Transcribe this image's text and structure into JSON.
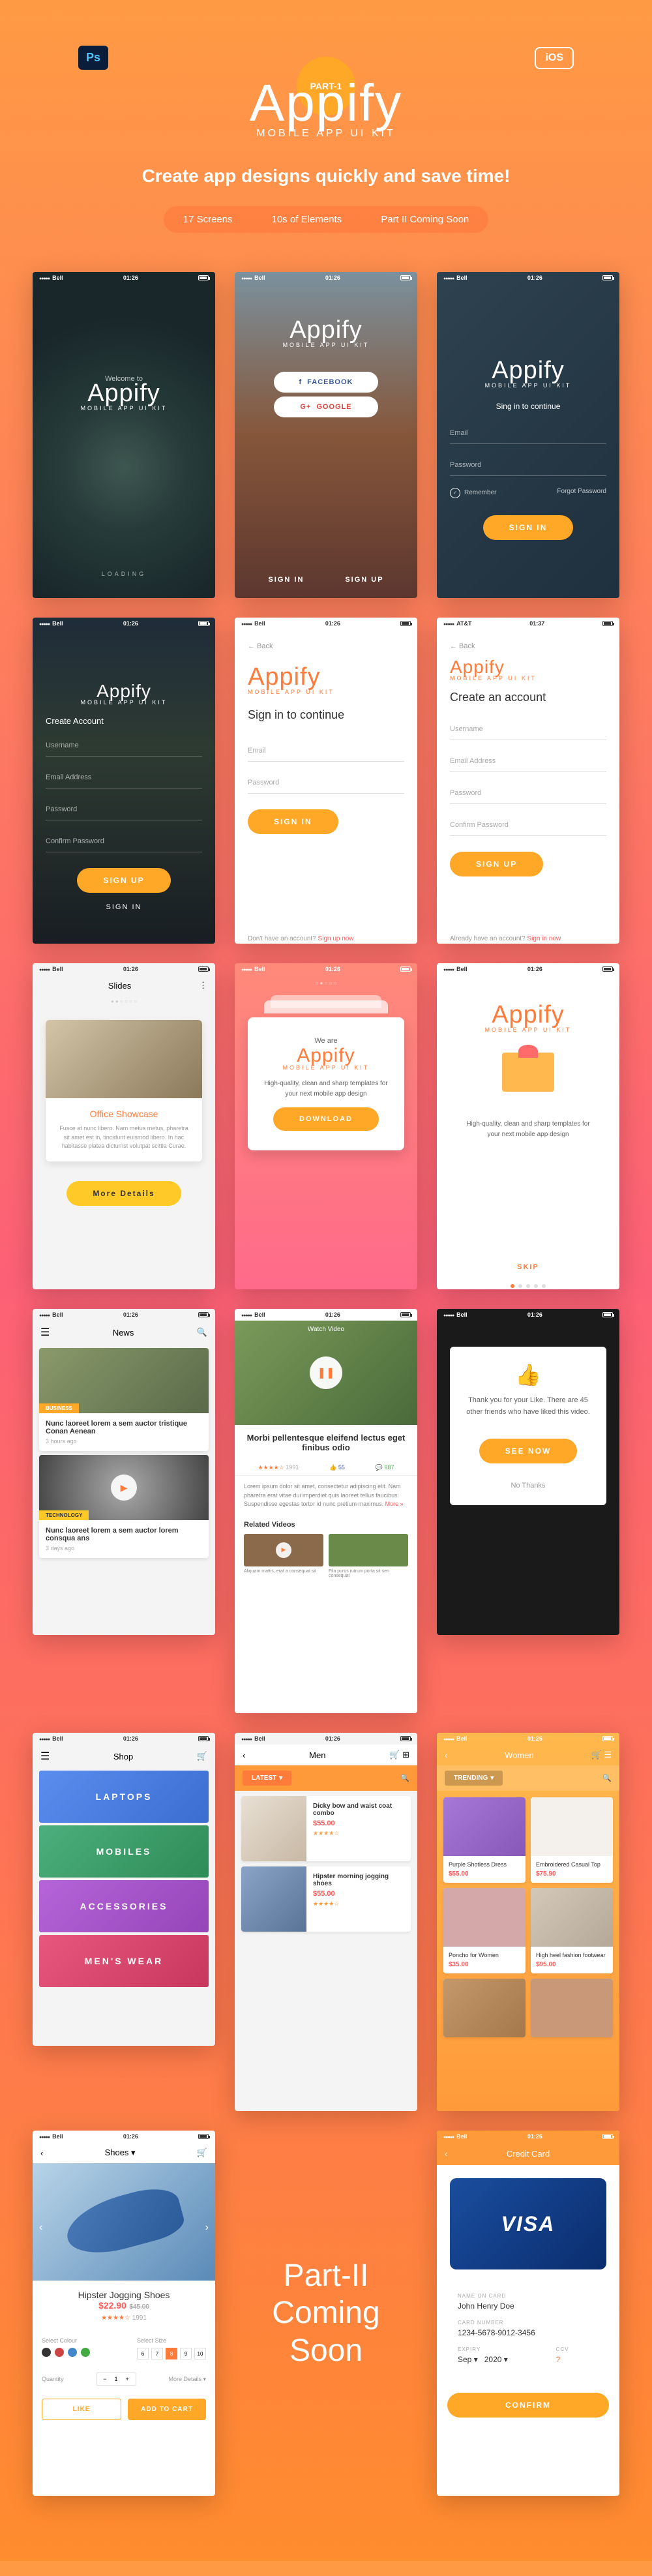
{
  "hero": {
    "part": "PART-1",
    "title": "Appify",
    "subtitle": "MOBILE APP UI KIT",
    "tagline": "Create app designs quickly and save time!",
    "pills": [
      "17 Screens",
      "10s of Elements",
      "Part II Coming Soon"
    ],
    "ps": "Ps",
    "ios": "iOS"
  },
  "status": {
    "carrier": "Bell",
    "time": "01:26",
    "att": "AT&T",
    "time2": "01:37"
  },
  "s1": {
    "welcome": "Welcome to",
    "title": "Appify",
    "sub": "MOBILE APP UI KIT",
    "loading": "LOADING"
  },
  "s2": {
    "title": "Appify",
    "sub": "MOBILE APP UI KIT",
    "fb": "FACEBOOK",
    "gg": "GOOGLE",
    "signin": "SIGN IN",
    "signup": "SIGN UP"
  },
  "s3": {
    "title": "Appify",
    "sub": "MOBILE APP UI KIT",
    "heading": "Sing in to continue",
    "email": "Email",
    "password": "Password",
    "remember": "Remember",
    "forgot": "Forgot Password",
    "btn": "SIGN IN"
  },
  "s4": {
    "title": "Appify",
    "sub": "MOBILE APP UI KIT",
    "heading": "Create Account",
    "f1": "Username",
    "f2": "Email Address",
    "f3": "Password",
    "f4": "Confirm Password",
    "btn": "SIGN UP",
    "link": "SIGN IN"
  },
  "s5": {
    "back": "← Back",
    "title": "Appify",
    "sub": "MOBILE APP UI KIT",
    "heading": "Sign in to continue",
    "f1": "Email",
    "f2": "Password",
    "btn": "SIGN IN",
    "footer": "Don't have an account?",
    "footerLink": "Sign up now"
  },
  "s6": {
    "back": "← Back",
    "title": "Appify",
    "sub": "MOBILE APP UI KIT",
    "heading": "Create an account",
    "f1": "Username",
    "f2": "Email Address",
    "f3": "Password",
    "f4": "Confirm Password",
    "btn": "SIGN UP",
    "footer": "Already have an account?",
    "footerLink": "Sign in now"
  },
  "s7": {
    "header": "Slides",
    "title": "Office Showcase",
    "desc": "Fusce at nunc libero. Nam metus metus, pharetra sit amet est in, tincidunt euismod libero. In hac habitasse platea dictumst volutpat scittla Curae.",
    "btn": "More Details"
  },
  "s8": {
    "pre": "We are",
    "title": "Appify",
    "sub": "MOBILE APP UI KIT",
    "desc": "High-quality, clean and sharp templates for your next mobile app design",
    "btn": "DOWNLOAD"
  },
  "s9": {
    "title": "Appify",
    "sub": "MOBILE APP UI KIT",
    "desc": "High-quality, clean and sharp templates for your next mobile app design",
    "skip": "SKIP"
  },
  "s10": {
    "header": "News",
    "tag1": "BUSINESS",
    "t1": "Nunc laoreet lorem a sem auctor tristique Conan Aenean",
    "m1": "3 hours ago",
    "tag2": "TECHNOLOGY",
    "t2": "Nunc laoreet lorem a sem auctor lorem consqua ans",
    "m2": "3 days ago"
  },
  "s11": {
    "watch": "Watch Video",
    "title": "Morbi pellentesque eleifend lectus eget finibus odio",
    "rating": "★★★★☆",
    "reviews": "1991",
    "likes": "55",
    "comments": "987",
    "desc": "Lorem ipsum dolor sit amet, consectetur adipiscing elit. Nam pharetra erat vitae dui imperdiet quis laoreet tellus faucibus. Suspendisse egestas tortor id nunc pretium maximus.",
    "more": "More »",
    "rel": "Related Videos",
    "r1": "Aliquam mattis, erat a consequat sit",
    "r2": "Fila purus rutrum porta sit sen consequat"
  },
  "s12": {
    "text": "Thank you for your Like. There are 45 other friends who have liked this video.",
    "btn": "SEE NOW",
    "no": "No Thanks"
  },
  "s13": {
    "header": "Shop",
    "c1": "LAPTOPS",
    "c2": "MOBILES",
    "c3": "ACCESSORIES",
    "c4": "MEN'S WEAR"
  },
  "s14": {
    "header": "Women",
    "tab": "TRENDING",
    "p1n": "Purple Shotless Dress",
    "p1p": "$55.00",
    "p2n": "Embroidered Casual Top",
    "p2p": "$75.90",
    "p3n": "Poncho for Women",
    "p3p": "$35.00",
    "p4n": "High heel fashion footwear",
    "p4p": "$95.00"
  },
  "s15": {
    "header": "Men",
    "tab": "LATEST",
    "p1n": "Dicky bow and waist coat combo",
    "p1p": "$55.00",
    "p2n": "Hipster morning jogging shoes",
    "p2p": "$55.00"
  },
  "s16": {
    "header": "Shoes",
    "name": "Hipster Jogging Shoes",
    "price": "$22.90",
    "old": "$45.00",
    "stars": "★★★★☆",
    "reviews": "1991",
    "colLabel": "Select Colour",
    "sizeLabel": "Select Size",
    "sizes": [
      "6",
      "7",
      "8",
      "9",
      "10"
    ],
    "qtyLabel": "Quantity",
    "qty": "1",
    "btn1": "More Details ▾",
    "btnL": "LIKE",
    "btnR": "ADD TO CART"
  },
  "s17": {
    "header": "Credit Card",
    "brand": "VISA",
    "l1": "NAME ON CARD",
    "v1": "John Henry Doe",
    "l2": "CARD NUMBER",
    "v2": "1234-5678-9012-3456",
    "l3": "EXPIRY",
    "v3a": "Sep",
    "v3b": "2020",
    "l4": "CCV",
    "v4": "?",
    "btn": "CONFIRM"
  },
  "coming": "Part-II Coming Soon"
}
